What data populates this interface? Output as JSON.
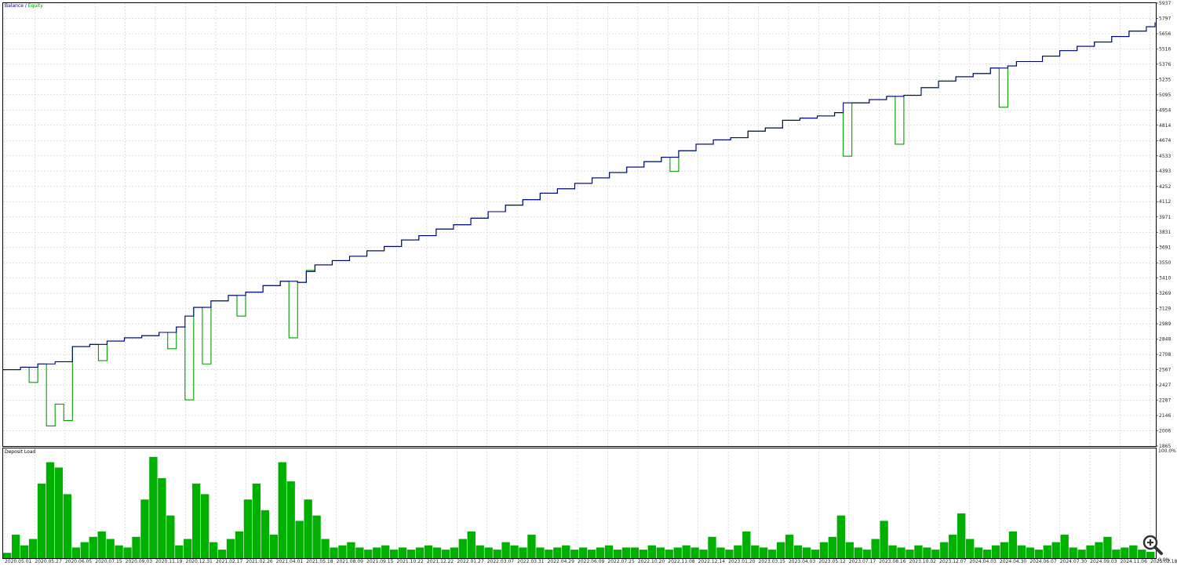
{
  "colors": {
    "balance": "#000080",
    "equity": "#00a000",
    "deposit_load": "#00b000",
    "grid": "#c8c8c8",
    "frame": "#000000",
    "label_balance": "#000080",
    "label_equity": "#009000"
  },
  "legend": {
    "balance_label": "Balance",
    "separator": " / ",
    "equity_label": "Equity"
  },
  "deposit_panel": {
    "title": "Deposit Load",
    "top_label": "100.0%",
    "bottom_label": "0.0%"
  },
  "zoom_icon": "magnifier-plus-icon",
  "chart_data": [
    {
      "type": "line",
      "title": "Balance / Equity",
      "x_tick_labels": [
        "2020.05.01",
        "2020.05.27",
        "2020.06.05",
        "2020.07.15",
        "2020.09.03",
        "2020.11.19",
        "2020.12.31",
        "2021.02.17",
        "2021.02.26",
        "2021.04.01",
        "2021.05.18",
        "2021.08.09",
        "2021.09.15",
        "2021.10.22",
        "2021.12.22",
        "2022.01.27",
        "2022.03.07",
        "2022.03.31",
        "2022.04.29",
        "2022.06.09",
        "2022.07.25",
        "2022.10.20",
        "2022.11.08",
        "2022.12.14",
        "2023.01.20",
        "2023.03.15",
        "2023.04.03",
        "2023.05.12",
        "2023.07.17",
        "2023.08.16",
        "2023.10.02",
        "2023.12.07",
        "2024.04.03",
        "2024.04.30",
        "2024.06.07",
        "2024.07.30",
        "2024.09.03",
        "2024.11.06",
        "2025.02.18"
      ],
      "y_tick_labels": [
        "1865",
        "2006",
        "2146",
        "2287",
        "2427",
        "2567",
        "2708",
        "2848",
        "2989",
        "3129",
        "3269",
        "3410",
        "3550",
        "3691",
        "3831",
        "3971",
        "4112",
        "4252",
        "4393",
        "4533",
        "4674",
        "4814",
        "4954",
        "5095",
        "5235",
        "5376",
        "5516",
        "5656",
        "5797",
        "5937"
      ],
      "ylim": [
        1865,
        5937
      ],
      "series": [
        {
          "name": "Balance",
          "points": [
            [
              0,
              2567
            ],
            [
              2,
              2590
            ],
            [
              4,
              2620
            ],
            [
              6,
              2640
            ],
            [
              8,
              2780
            ],
            [
              10,
              2800
            ],
            [
              12,
              2830
            ],
            [
              14,
              2860
            ],
            [
              16,
              2880
            ],
            [
              18,
              2910
            ],
            [
              20,
              2960
            ],
            [
              21,
              3060
            ],
            [
              22,
              3140
            ],
            [
              24,
              3200
            ],
            [
              26,
              3250
            ],
            [
              28,
              3280
            ],
            [
              30,
              3340
            ],
            [
              32,
              3380
            ],
            [
              34,
              3370
            ],
            [
              35,
              3470
            ],
            [
              36,
              3530
            ],
            [
              38,
              3570
            ],
            [
              40,
              3610
            ],
            [
              42,
              3660
            ],
            [
              44,
              3700
            ],
            [
              46,
              3760
            ],
            [
              48,
              3800
            ],
            [
              50,
              3860
            ],
            [
              52,
              3900
            ],
            [
              54,
              3960
            ],
            [
              56,
              4020
            ],
            [
              58,
              4080
            ],
            [
              60,
              4130
            ],
            [
              62,
              4190
            ],
            [
              64,
              4230
            ],
            [
              66,
              4280
            ],
            [
              68,
              4330
            ],
            [
              70,
              4380
            ],
            [
              72,
              4430
            ],
            [
              74,
              4480
            ],
            [
              76,
              4520
            ],
            [
              78,
              4580
            ],
            [
              80,
              4640
            ],
            [
              82,
              4680
            ],
            [
              84,
              4700
            ],
            [
              86,
              4760
            ],
            [
              88,
              4790
            ],
            [
              90,
              4860
            ],
            [
              92,
              4880
            ],
            [
              94,
              4900
            ],
            [
              96,
              4930
            ],
            [
              97,
              5020
            ],
            [
              100,
              5050
            ],
            [
              102,
              5080
            ],
            [
              104,
              5090
            ],
            [
              106,
              5160
            ],
            [
              108,
              5220
            ],
            [
              110,
              5260
            ],
            [
              112,
              5290
            ],
            [
              114,
              5340
            ],
            [
              116,
              5360
            ],
            [
              117,
              5400
            ],
            [
              120,
              5450
            ],
            [
              122,
              5500
            ],
            [
              124,
              5540
            ],
            [
              126,
              5580
            ],
            [
              128,
              5630
            ],
            [
              130,
              5680
            ],
            [
              132,
              5720
            ],
            [
              133,
              5760
            ]
          ]
        },
        {
          "name": "Equity",
          "points": [
            [
              0,
              2567
            ],
            [
              2,
              2590
            ],
            [
              3,
              2450
            ],
            [
              4,
              2620
            ],
            [
              5,
              2050
            ],
            [
              6,
              2250
            ],
            [
              7,
              2100
            ],
            [
              8,
              2780
            ],
            [
              10,
              2800
            ],
            [
              11,
              2650
            ],
            [
              12,
              2830
            ],
            [
              14,
              2860
            ],
            [
              16,
              2880
            ],
            [
              18,
              2910
            ],
            [
              19,
              2760
            ],
            [
              20,
              2960
            ],
            [
              21,
              2290
            ],
            [
              22,
              3140
            ],
            [
              23,
              2620
            ],
            [
              24,
              3200
            ],
            [
              26,
              3250
            ],
            [
              27,
              3060
            ],
            [
              28,
              3280
            ],
            [
              30,
              3340
            ],
            [
              32,
              3380
            ],
            [
              33,
              2860
            ],
            [
              34,
              3370
            ],
            [
              35,
              3480
            ],
            [
              36,
              3530
            ],
            [
              38,
              3570
            ],
            [
              40,
              3610
            ],
            [
              42,
              3660
            ],
            [
              44,
              3700
            ],
            [
              46,
              3760
            ],
            [
              48,
              3800
            ],
            [
              50,
              3860
            ],
            [
              52,
              3900
            ],
            [
              54,
              3960
            ],
            [
              56,
              4020
            ],
            [
              58,
              4080
            ],
            [
              60,
              4130
            ],
            [
              62,
              4190
            ],
            [
              64,
              4230
            ],
            [
              66,
              4280
            ],
            [
              68,
              4330
            ],
            [
              70,
              4380
            ],
            [
              72,
              4430
            ],
            [
              74,
              4480
            ],
            [
              76,
              4520
            ],
            [
              77,
              4390
            ],
            [
              78,
              4580
            ],
            [
              80,
              4640
            ],
            [
              82,
              4680
            ],
            [
              84,
              4700
            ],
            [
              86,
              4760
            ],
            [
              88,
              4790
            ],
            [
              90,
              4860
            ],
            [
              92,
              4880
            ],
            [
              94,
              4900
            ],
            [
              96,
              4930
            ],
            [
              97,
              4530
            ],
            [
              98,
              5020
            ],
            [
              100,
              5050
            ],
            [
              102,
              5080
            ],
            [
              103,
              4640
            ],
            [
              104,
              5090
            ],
            [
              106,
              5160
            ],
            [
              108,
              5220
            ],
            [
              110,
              5260
            ],
            [
              112,
              5290
            ],
            [
              114,
              5340
            ],
            [
              115,
              4980
            ],
            [
              116,
              5360
            ],
            [
              117,
              5400
            ],
            [
              120,
              5450
            ],
            [
              122,
              5500
            ],
            [
              124,
              5540
            ],
            [
              126,
              5580
            ],
            [
              128,
              5630
            ],
            [
              130,
              5680
            ],
            [
              132,
              5720
            ],
            [
              133,
              5760
            ]
          ]
        }
      ]
    },
    {
      "type": "area",
      "title": "Deposit Load",
      "ylim": [
        0,
        100
      ],
      "unit": "%",
      "x_tick_labels": [
        "2020.05.01",
        "2020.05.27",
        "2020.06.05",
        "2020.07.15",
        "2020.09.03",
        "2020.11.19",
        "2020.12.31",
        "2021.02.17",
        "2021.02.26",
        "2021.04.01",
        "2021.05.18",
        "2021.08.09",
        "2021.09.15",
        "2021.10.22",
        "2021.12.22",
        "2022.01.27",
        "2022.03.07",
        "2022.03.31",
        "2022.04.29",
        "2022.06.09",
        "2022.07.25",
        "2022.10.20",
        "2022.11.08",
        "2022.12.14",
        "2023.01.20",
        "2023.03.15",
        "2023.04.03",
        "2023.05.12",
        "2023.07.17",
        "2023.08.16",
        "2023.10.02",
        "2023.12.07",
        "2024.04.03",
        "2024.04.30",
        "2024.06.07",
        "2024.07.30",
        "2024.09.03",
        "2024.11.06",
        "2025.02.18"
      ],
      "values": [
        5,
        22,
        12,
        18,
        70,
        90,
        85,
        60,
        10,
        15,
        20,
        25,
        18,
        12,
        10,
        20,
        55,
        95,
        75,
        40,
        12,
        18,
        70,
        60,
        15,
        8,
        18,
        25,
        55,
        70,
        45,
        22,
        90,
        72,
        35,
        55,
        40,
        18,
        10,
        12,
        15,
        10,
        8,
        10,
        12,
        8,
        10,
        8,
        10,
        12,
        10,
        8,
        10,
        18,
        25,
        12,
        10,
        8,
        15,
        12,
        10,
        22,
        10,
        8,
        10,
        12,
        8,
        10,
        8,
        10,
        12,
        8,
        10,
        10,
        8,
        12,
        10,
        8,
        10,
        12,
        10,
        8,
        20,
        10,
        8,
        12,
        25,
        12,
        10,
        8,
        15,
        22,
        12,
        10,
        8,
        15,
        20,
        40,
        15,
        10,
        8,
        18,
        35,
        12,
        10,
        8,
        12,
        10,
        8,
        15,
        22,
        42,
        18,
        10,
        8,
        12,
        15,
        25,
        12,
        10,
        8,
        12,
        15,
        22,
        10,
        8,
        12,
        15,
        20,
        8,
        10,
        12,
        8,
        6
      ]
    }
  ]
}
